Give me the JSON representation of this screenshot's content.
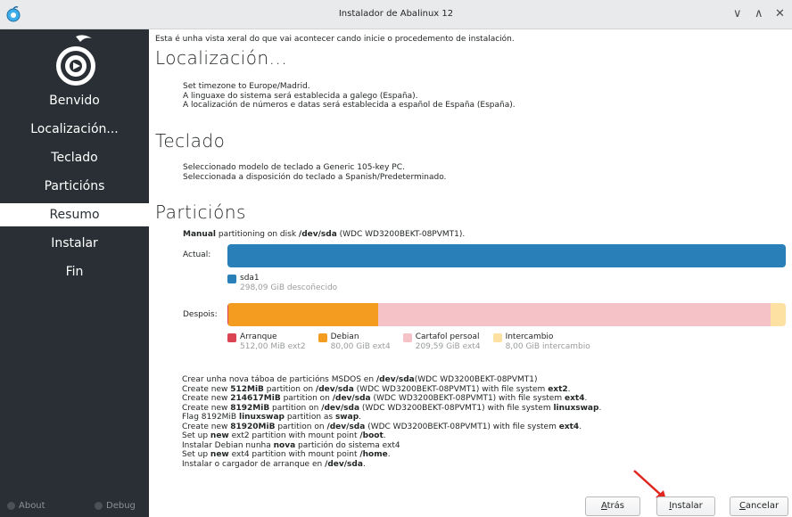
{
  "window": {
    "title": "Instalador de Abalinux 12",
    "controls": [
      "∨",
      "∧",
      "✕"
    ]
  },
  "sidebar": {
    "steps": [
      {
        "label": "Benvido",
        "active": false
      },
      {
        "label": "Localización...",
        "active": false
      },
      {
        "label": "Teclado",
        "active": false
      },
      {
        "label": "Particións",
        "active": false
      },
      {
        "label": "Resumo",
        "active": true
      },
      {
        "label": "Instalar",
        "active": false
      },
      {
        "label": "Fin",
        "active": false
      }
    ],
    "footer": {
      "about": "About",
      "debug": "Debug"
    }
  },
  "main": {
    "intro": "Esta é unha vista xeral do que vai acontecer cando inicie o procedemento de instalación.",
    "localization": {
      "title": "Localización...",
      "lines": [
        "Set timezone to Europe/Madrid.",
        "A linguaxe do sistema será establecida a galego (España).",
        "A localización de números e datas será establecida a español de España (España)."
      ]
    },
    "keyboard": {
      "title": "Teclado",
      "lines": [
        "Seleccionado modelo de teclado a Generic 105-key PC.",
        "Seleccionada a disposición do teclado a Spanish/Predeterminado."
      ]
    },
    "partitions": {
      "title": "Particións",
      "summary_bold": "Manual",
      "summary_mid": " partitioning on disk ",
      "summary_disk": "/dev/sda",
      "summary_end": " (WDC WD3200BEKT-08PVMT1).",
      "current_label": "Actual:",
      "after_label": "Despois:",
      "current_partitions": [
        {
          "name": "sda1",
          "detail": "298,09 GiB  descoñecido",
          "color": "#2980b9",
          "fraction": 1.0
        }
      ],
      "after_partitions": [
        {
          "name": "Arranque",
          "detail": "512,00 MiB  ext2",
          "color": "#da4453",
          "fraction": 0.0017
        },
        {
          "name": "Debian",
          "detail": "80,00 GiB  ext4",
          "color": "#f39c1f",
          "fraction": 0.2684
        },
        {
          "name": "Cartafol persoal",
          "detail": "209,59 GiB  ext4",
          "color": "#f5c2c7",
          "fraction": 0.7031
        },
        {
          "name": "Intercambio",
          "detail": "8,00 GiB  intercambio",
          "color": "#fde1a3",
          "fraction": 0.0268
        }
      ]
    },
    "jobs": [
      [
        {
          "t": "Crear unha nova táboa de particións MSDOS en "
        },
        {
          "t": "/dev/sda",
          "b": true
        },
        {
          "t": "(WDC WD3200BEKT-08PVMT1)"
        }
      ],
      [
        {
          "t": "Create new "
        },
        {
          "t": "512MiB",
          "b": true
        },
        {
          "t": " partition on "
        },
        {
          "t": "/dev/sda",
          "b": true
        },
        {
          "t": " (WDC WD3200BEKT-08PVMT1) with file system "
        },
        {
          "t": "ext2",
          "b": true
        },
        {
          "t": "."
        }
      ],
      [
        {
          "t": "Create new "
        },
        {
          "t": "214617MiB",
          "b": true
        },
        {
          "t": " partition on "
        },
        {
          "t": "/dev/sda",
          "b": true
        },
        {
          "t": " (WDC WD3200BEKT-08PVMT1) with file system "
        },
        {
          "t": "ext4",
          "b": true
        },
        {
          "t": "."
        }
      ],
      [
        {
          "t": "Create new "
        },
        {
          "t": "8192MiB",
          "b": true
        },
        {
          "t": " partition on "
        },
        {
          "t": "/dev/sda",
          "b": true
        },
        {
          "t": " (WDC WD3200BEKT-08PVMT1) with file system "
        },
        {
          "t": "linuxswap",
          "b": true
        },
        {
          "t": "."
        }
      ],
      [
        {
          "t": "Flag 8192MiB "
        },
        {
          "t": "linuxswap",
          "b": true
        },
        {
          "t": " partition as "
        },
        {
          "t": "swap",
          "b": true
        },
        {
          "t": "."
        }
      ],
      [
        {
          "t": "Create new "
        },
        {
          "t": "81920MiB",
          "b": true
        },
        {
          "t": " partition on "
        },
        {
          "t": "/dev/sda",
          "b": true
        },
        {
          "t": " (WDC WD3200BEKT-08PVMT1) with file system "
        },
        {
          "t": "ext4",
          "b": true
        },
        {
          "t": "."
        }
      ],
      [
        {
          "t": "Set up "
        },
        {
          "t": "new",
          "b": true
        },
        {
          "t": " ext2 partition with mount point "
        },
        {
          "t": "/boot",
          "b": true
        },
        {
          "t": "."
        }
      ],
      [
        {
          "t": "Instalar Debian nunha "
        },
        {
          "t": "nova",
          "b": true
        },
        {
          "t": " partición do sistema ext4"
        }
      ],
      [
        {
          "t": "Set up "
        },
        {
          "t": "new",
          "b": true
        },
        {
          "t": " ext4 partition with mount point "
        },
        {
          "t": "/home",
          "b": true
        },
        {
          "t": "."
        }
      ],
      [
        {
          "t": "Instalar o cargador de arranque en "
        },
        {
          "t": "/dev/sda",
          "b": true
        },
        {
          "t": "."
        }
      ]
    ]
  },
  "buttons": {
    "back": {
      "mnemonic": "A",
      "rest": "trás"
    },
    "install": {
      "mnemonic": "I",
      "rest": "nstalar"
    },
    "cancel": {
      "mnemonic": "C",
      "rest": "ancelar"
    }
  }
}
